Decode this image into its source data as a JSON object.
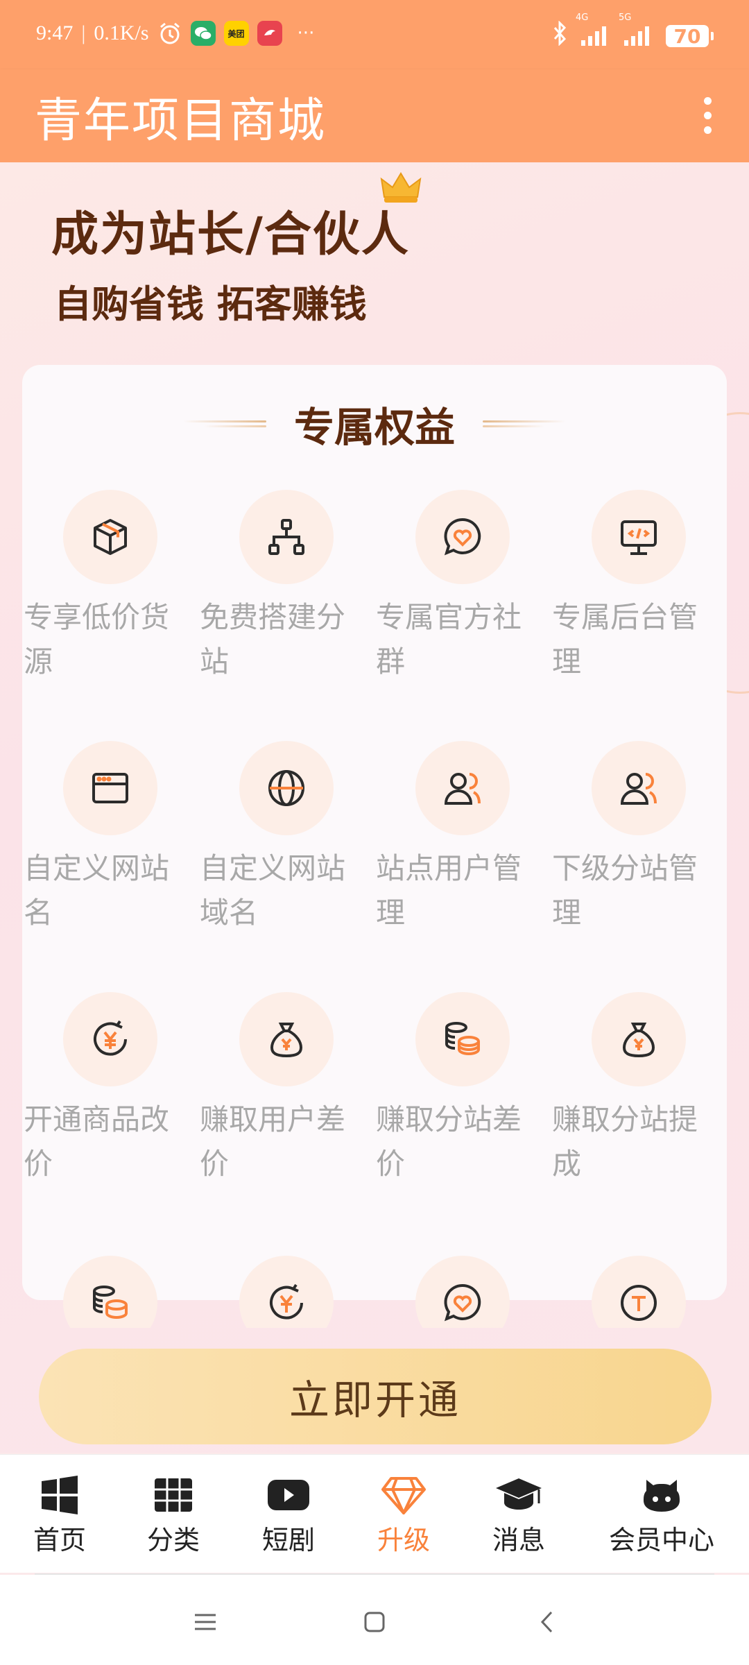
{
  "status_bar": {
    "time": "9:47",
    "net_speed": "0.1K/s",
    "meituan_label": "美团",
    "more": "···",
    "net_4g": "4G",
    "net_5g": "5G",
    "battery": "70"
  },
  "app_bar": {
    "title": "青年项目商城"
  },
  "hero": {
    "title": "成为站长/合伙人",
    "subtitle": "自购省钱 拓客赚钱"
  },
  "benefits_card": {
    "title": "专属权益",
    "items": [
      {
        "label": "专享低价货源",
        "icon": "package-icon"
      },
      {
        "label": "免费搭建分站",
        "icon": "hierarchy-icon"
      },
      {
        "label": "专属官方社群",
        "icon": "heart-chat-icon"
      },
      {
        "label": "专属后台管理",
        "icon": "code-monitor-icon"
      },
      {
        "label": "自定义网站名",
        "icon": "browser-window-icon"
      },
      {
        "label": "自定义网站域名",
        "icon": "globe-icon"
      },
      {
        "label": "站点用户管理",
        "icon": "users-icon"
      },
      {
        "label": "下级分站管理",
        "icon": "users-icon"
      },
      {
        "label": "开通商品改价",
        "icon": "yuan-refresh-icon"
      },
      {
        "label": "赚取用户差价",
        "icon": "money-bag-icon"
      },
      {
        "label": "赚取分站差价",
        "icon": "coins-icon"
      },
      {
        "label": "赚取分站提成",
        "icon": "money-bag-icon"
      }
    ],
    "overflow_icons": [
      "coins-icon",
      "yuan-refresh-icon",
      "heart-chat-icon",
      "t-coin-icon"
    ]
  },
  "cta": {
    "label": "立即开通"
  },
  "tabbar": {
    "tabs": [
      {
        "label": "首页",
        "icon": "windows-icon"
      },
      {
        "label": "分类",
        "icon": "grid-icon"
      },
      {
        "label": "短剧",
        "icon": "play-icon"
      },
      {
        "label": "升级",
        "icon": "diamond-icon",
        "active": true
      },
      {
        "label": "消息",
        "icon": "graduation-cap-icon"
      },
      {
        "label": "会员中心",
        "icon": "octocat-icon"
      }
    ]
  },
  "colors": {
    "brand_orange": "#fea06a",
    "accent_orange": "#f9823b",
    "title_brown": "#5c2a0f",
    "cta_gold": "#f8d58e"
  }
}
